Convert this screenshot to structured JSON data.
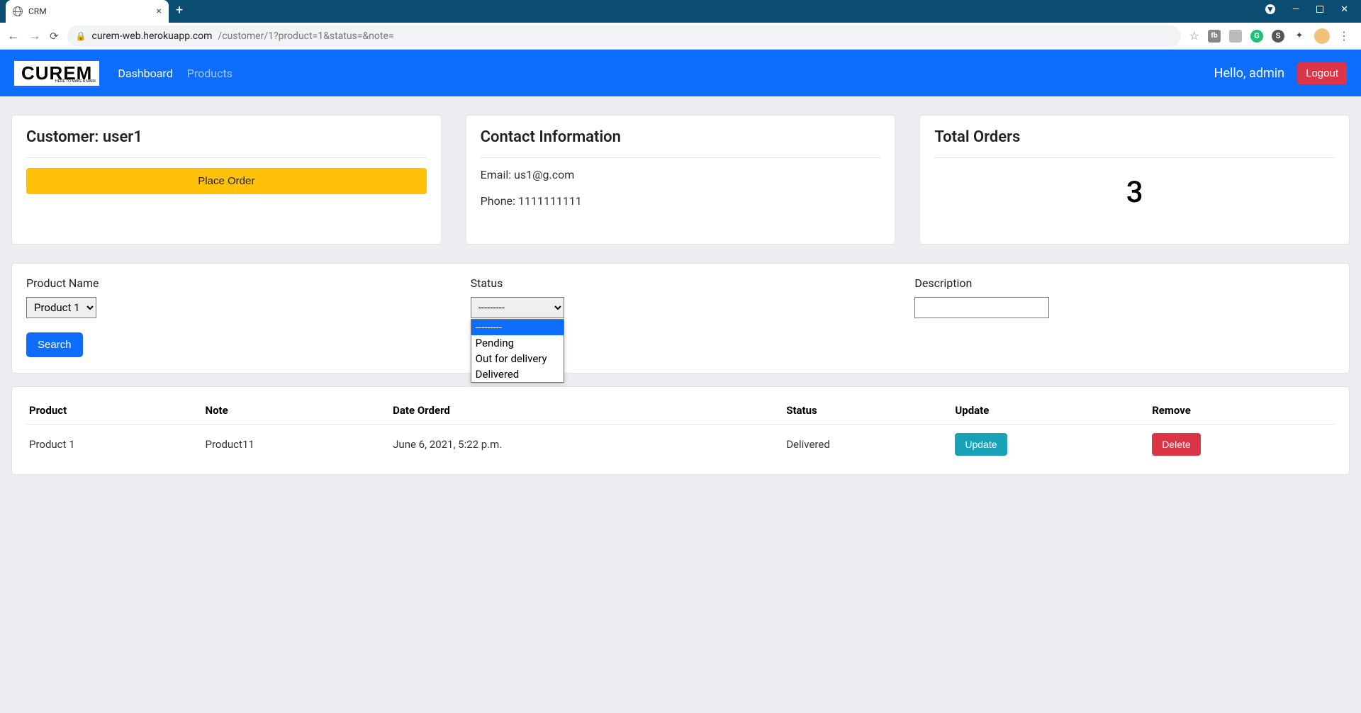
{
  "browser": {
    "tab_title": "CRM",
    "url_host": "curem-web.herokuapp.com",
    "url_path": "/customer/1?product=1&status=&note="
  },
  "nav": {
    "logo_text": "CUREM",
    "logo_sub": "HERE TO MAKE A MARK",
    "links": {
      "dashboard": "Dashboard",
      "products": "Products"
    },
    "hello": "Hello, admin",
    "logout": "Logout"
  },
  "cards": {
    "customer_heading": "Customer: user1",
    "place_order": "Place Order",
    "contact_heading": "Contact Information",
    "email_line": "Email: us1@g.com",
    "phone_line": "Phone: 1111111111",
    "total_heading": "Total Orders",
    "total_value": "3"
  },
  "filter": {
    "product_label": "Product Name",
    "product_selected": "Product 1",
    "status_label": "Status",
    "status_selected": "---------",
    "status_options": [
      "---------",
      "Pending",
      "Out for delivery",
      "Delivered"
    ],
    "description_label": "Description",
    "description_value": "",
    "search_btn": "Search"
  },
  "table": {
    "headers": {
      "product": "Product",
      "note": "Note",
      "date": "Date Orderd",
      "status": "Status",
      "update": "Update",
      "remove": "Remove"
    },
    "rows": [
      {
        "product": "Product 1",
        "note": "Product11",
        "date": "June 6, 2021, 5:22 p.m.",
        "status": "Delivered",
        "update": "Update",
        "remove": "Delete"
      }
    ]
  }
}
